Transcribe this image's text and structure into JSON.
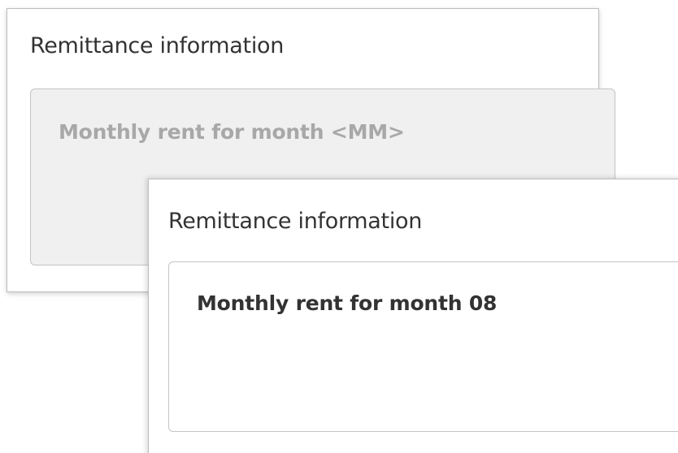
{
  "template_panel": {
    "label": "Remittance information",
    "field_value": "Monthly rent for month <MM>",
    "field_state": "disabled"
  },
  "filled_panel": {
    "label": "Remittance information",
    "field_value": "Monthly rent for month 08",
    "field_state": "editable"
  },
  "colors": {
    "label_text": "#333333",
    "disabled_text": "#a8a8a8",
    "disabled_bg": "#f0f0f0",
    "border": "#c4c4c4"
  }
}
